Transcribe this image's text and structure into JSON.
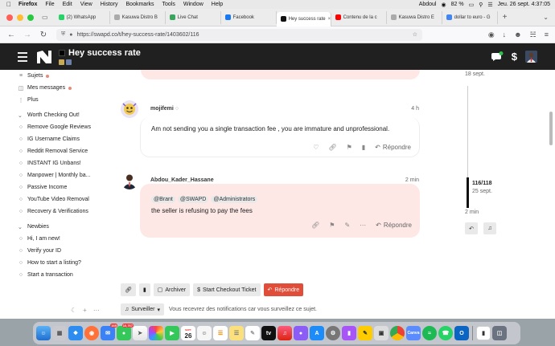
{
  "menubar": {
    "app": "Firefox",
    "items": [
      "File",
      "Edit",
      "View",
      "History",
      "Bookmarks",
      "Tools",
      "Window",
      "Help"
    ],
    "user": "Abdoul",
    "battery": "82 %",
    "clock": "Jeu. 26 sept.  4:37:05"
  },
  "tabs": [
    {
      "label": "(2) WhatsApp",
      "color": "#25d366"
    },
    {
      "label": "Kasuwa Distro B",
      "color": "#aaaaaa"
    },
    {
      "label": "Live Chat",
      "color": "#3aa55d"
    },
    {
      "label": "Facebook",
      "color": "#1877f2"
    },
    {
      "label": "Hey success rate",
      "color": "#111111",
      "active": true
    },
    {
      "label": "Contenu de la c",
      "color": "#ff0000"
    },
    {
      "label": "Kasuwa Distro E",
      "color": "#aaaaaa"
    },
    {
      "label": "dollar to euro - G",
      "color": "#4285f4"
    }
  ],
  "url": "https://swapd.co/t/hey-success-rate/1403602/116",
  "site": {
    "title": "Hey success rate"
  },
  "sidebar": {
    "top": [
      {
        "label": "Sujets",
        "icon": "list-icon",
        "dot": true
      },
      {
        "label": "Mes messages",
        "icon": "inbox-icon",
        "dot": true
      },
      {
        "label": "Plus",
        "icon": "more-icon",
        "dot": false
      }
    ],
    "section1": {
      "title": "Worth Checking Out!",
      "items": [
        {
          "label": "Remove Google Reviews"
        },
        {
          "label": "IG Username Claims"
        },
        {
          "label": "Reddit Removal Service"
        },
        {
          "label": "INSTANT IG Unbans!"
        },
        {
          "label": "Manpower | Monthly ba..."
        },
        {
          "label": "Passive Income"
        },
        {
          "label": "YouTube Video Removal"
        },
        {
          "label": "Recovery & Verifications"
        }
      ]
    },
    "section2": {
      "title": "Newbies",
      "items": [
        {
          "label": "Hi, I am new!"
        },
        {
          "label": "Verify your ID"
        },
        {
          "label": "How to start a listing?"
        },
        {
          "label": "Start a transaction"
        }
      ]
    }
  },
  "posts": [
    {
      "author": "mojifemi",
      "time": "4 h",
      "text": "Am not sending you a single transaction fee , you are immature and unprofessional.",
      "reply": "Répondre"
    },
    {
      "author": "Abdou_Kader_Hassane",
      "time": "2 min",
      "mentions": [
        "@Brant",
        "@SWAPD",
        "@Administrators"
      ],
      "text": "the seller is refusing to pay the fees",
      "reply": "Répondre"
    }
  ],
  "controls": {
    "archive": "Archiver",
    "checkout": "Start Checkout Ticket",
    "reply": "Répondre",
    "watch": "Surveiller",
    "watch_note": "Vous recevrez des notifications car vous surveillez ce sujet."
  },
  "timeline": {
    "start": "18 sept.",
    "position": "116/118",
    "position_date": "25 sept.",
    "end": "2 min"
  },
  "dock": {
    "badges": {
      "mail": "169",
      "messages": "10,767"
    },
    "calendar_day": "26",
    "calendar_month": "SEPT."
  }
}
